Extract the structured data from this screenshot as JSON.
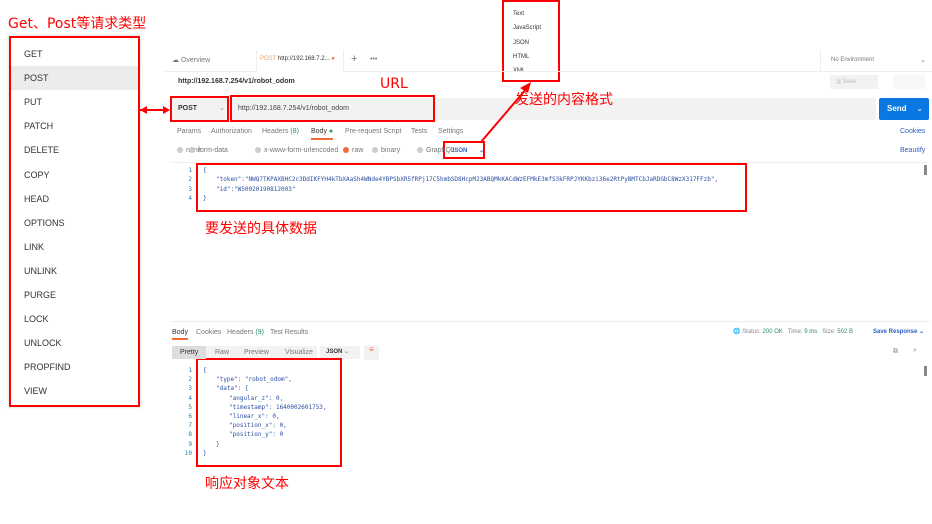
{
  "annotations": {
    "methods_title": "Get、Post等请求类型",
    "url": "URL",
    "format": "发送的内容格式",
    "body": "要发送的具体数据",
    "response": "响应对象文本"
  },
  "methods": [
    "GET",
    "POST",
    "PUT",
    "PATCH",
    "DELETE",
    "COPY",
    "HEAD",
    "OPTIONS",
    "LINK",
    "UNLINK",
    "PURGE",
    "LOCK",
    "UNLOCK",
    "PROPFIND",
    "VIEW"
  ],
  "selected_method_index": 1,
  "formats": [
    "Text",
    "JavaScript",
    "JSON",
    "HTML",
    "XML"
  ],
  "tabs": {
    "overview": "Overview",
    "active_method": "POST",
    "active_title": "http://192.168.7.2...",
    "more": "•••",
    "environment": "No Environment"
  },
  "request": {
    "title": "http://192.168.7.254/v1/robot_odom",
    "method": "POST",
    "url": "http://192.168.7.254/v1/robot_odom",
    "send": "Send",
    "save": "Save"
  },
  "req_tabs": [
    "Params",
    "Authorization",
    "Headers",
    "Body",
    "Pre-request Script",
    "Tests",
    "Settings"
  ],
  "headers_count": "(8)",
  "cookies": "Cookies",
  "beautify": "Beautify",
  "body_types": [
    "none",
    "form-data",
    "x-www-form-urlencoded",
    "raw",
    "binary",
    "GraphQL"
  ],
  "body_format": "JSON",
  "body_lines": [
    "{",
    "\"token\":\"NWQ7TKPAXBHC2c3DdIKFYH4kTbXAaSh4WNde4YBPSbXR5fRPj17C5hmbSD8HcpM23ABQMkKACdWzEFMkE3mfS3kFRPJYKKbzi36e2RtPyBMTCbJaRDGbC8WzX317FFzb\",",
    "\"id\":\"W50020190812003\"",
    "}"
  ],
  "response": {
    "tabs": [
      "Body",
      "Cookies",
      "Headers",
      "Test Results"
    ],
    "headers_count": "(9)",
    "status_label": "Status:",
    "status": "200 OK",
    "time_label": "Time:",
    "time": "9 ms",
    "size_label": "Size:",
    "size": "502 B",
    "save_response": "Save Response",
    "views": [
      "Pretty",
      "Raw",
      "Preview",
      "Visualize"
    ],
    "format": "JSON",
    "lines": [
      "{",
      "\"type\": \"robot_odom\",",
      "\"data\": {",
      "\"angular_z\": 0,",
      "\"timestamp\": 1640002601753,",
      "\"linear_x\": 0,",
      "\"position_x\": 0,",
      "\"position_y\": 0",
      "}",
      "}"
    ]
  }
}
